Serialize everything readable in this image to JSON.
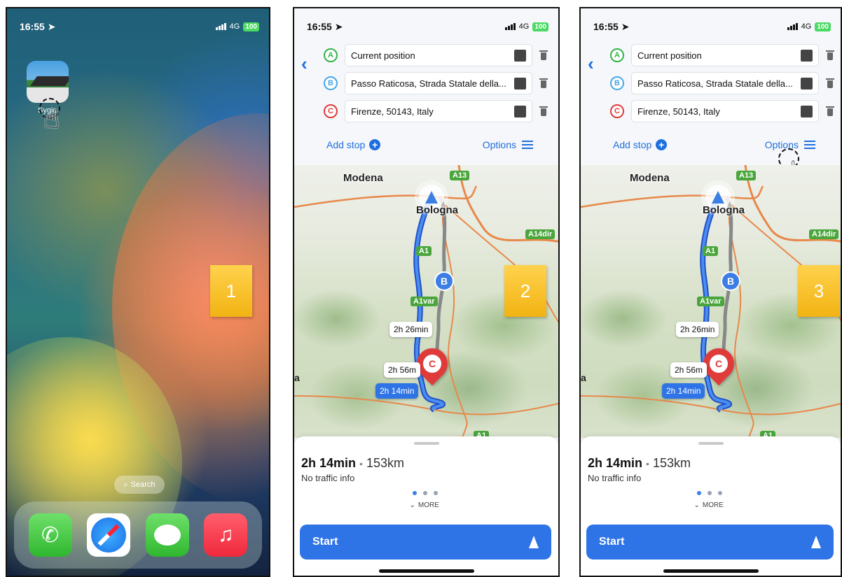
{
  "status": {
    "time": "16:55",
    "network": "4G",
    "battery": "100"
  },
  "screen1": {
    "app_label": "Sygic",
    "search_label": "Search",
    "step_number": "1"
  },
  "planner": {
    "stops": [
      {
        "marker": "A",
        "value": "Current position"
      },
      {
        "marker": "B",
        "value": "Passo Raticosa, Strada Statale della..."
      },
      {
        "marker": "C",
        "value": "Firenze, 50143, Italy"
      }
    ],
    "add_stop_label": "Add stop",
    "options_label": "Options",
    "map": {
      "cities": [
        "Modena",
        "Bologna"
      ],
      "highways": [
        "A13",
        "A14dir",
        "A1",
        "A1var",
        "A1"
      ],
      "marker_b": "B",
      "marker_c": "C",
      "route_times": [
        "2h 26min",
        "2h 56m",
        "2h 14min"
      ],
      "edge_label": "a"
    },
    "summary": {
      "duration": "2h 14min",
      "separator": "•",
      "distance": "153km",
      "traffic": "No traffic info"
    },
    "more_label": "MORE",
    "start_label": "Start"
  },
  "steps": [
    "2",
    "3"
  ],
  "colors": {
    "accent": "#2f74e6",
    "step": "#f2b313",
    "route": "#2f74e6",
    "pin_c": "#e03b3b"
  },
  "icons": [
    "location-arrow-icon",
    "signal-bars-icon",
    "tap-hand-icon",
    "trash-icon",
    "plus-circle-icon",
    "sliders-icon",
    "chevron-down-icon",
    "navigation-arrow-icon",
    "back-chevron-icon"
  ]
}
